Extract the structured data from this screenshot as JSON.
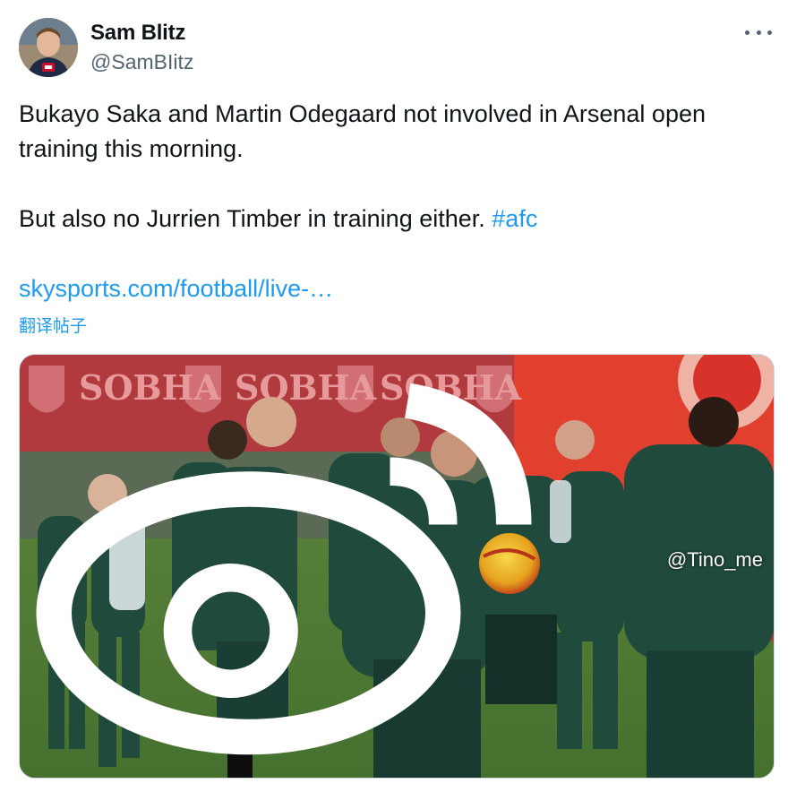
{
  "author": {
    "display_name": "Sam Blitz",
    "handle": "@SamBIitz"
  },
  "tweet": {
    "line1": "Bukayo Saka and Martin Odegaard not involved in Arsenal open training this morning.",
    "line2_text": "But also no Jurrien Timber in training either. ",
    "hashtag": "#afc",
    "link": "skysports.com/football/live-…",
    "translate_label": "翻译帖子"
  },
  "media": {
    "banner_text": [
      "SOBHA",
      "SOBHA",
      "SOBHA"
    ],
    "description_colors": {
      "banner": "#b03a3e",
      "grass": "#4f7a34",
      "kit": "#1f4a3c"
    }
  },
  "watermark": {
    "text": "@Tino_me",
    "icon": "weibo-icon"
  },
  "menu": {
    "icon": "more-icon"
  }
}
